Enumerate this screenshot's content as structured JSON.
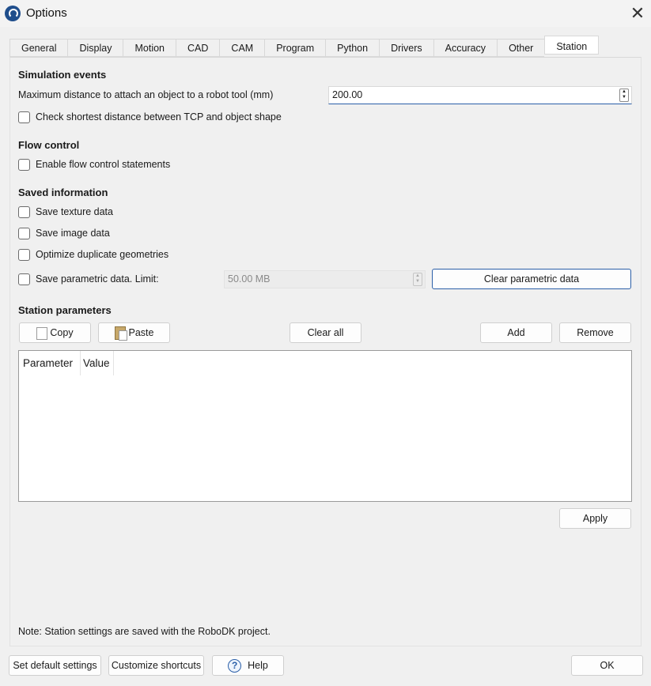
{
  "window": {
    "title": "Options",
    "close_glyph": "✕"
  },
  "tabs": [
    {
      "label": "General"
    },
    {
      "label": "Display"
    },
    {
      "label": "Motion"
    },
    {
      "label": "CAD"
    },
    {
      "label": "CAM"
    },
    {
      "label": "Program"
    },
    {
      "label": "Python"
    },
    {
      "label": "Drivers"
    },
    {
      "label": "Accuracy"
    },
    {
      "label": "Other"
    },
    {
      "label": "Station",
      "active": true
    }
  ],
  "simulation": {
    "heading": "Simulation events",
    "attach_distance_label": "Maximum distance to attach an object to a robot tool (mm)",
    "attach_distance_value": "200.00",
    "shortest_distance_label": "Check shortest distance between TCP and object shape",
    "shortest_distance_checked": false
  },
  "flow": {
    "heading": "Flow control",
    "enable_label": "Enable flow control statements",
    "enable_checked": false
  },
  "saved": {
    "heading": "Saved information",
    "texture_label": "Save texture data",
    "image_label": "Save image data",
    "optimize_label": "Optimize duplicate geometries",
    "parametric_label": "Save parametric data. Limit:",
    "parametric_limit_value": "50.00 MB",
    "clear_parametric_label": "Clear parametric data"
  },
  "station": {
    "heading": "Station parameters",
    "copy_label": "Copy",
    "paste_label": "Paste",
    "clear_all_label": "Clear all",
    "add_label": "Add",
    "remove_label": "Remove",
    "columns": [
      "Parameter",
      "Value"
    ],
    "apply_label": "Apply"
  },
  "note": "Note: Station settings are saved with the RoboDK project.",
  "footer": {
    "default_label": "Set default settings",
    "shortcuts_label": "Customize shortcuts",
    "help_label": "Help",
    "ok_label": "OK"
  },
  "colors": {
    "accent": "#2b5fa8",
    "background": "#f0f0f0"
  }
}
